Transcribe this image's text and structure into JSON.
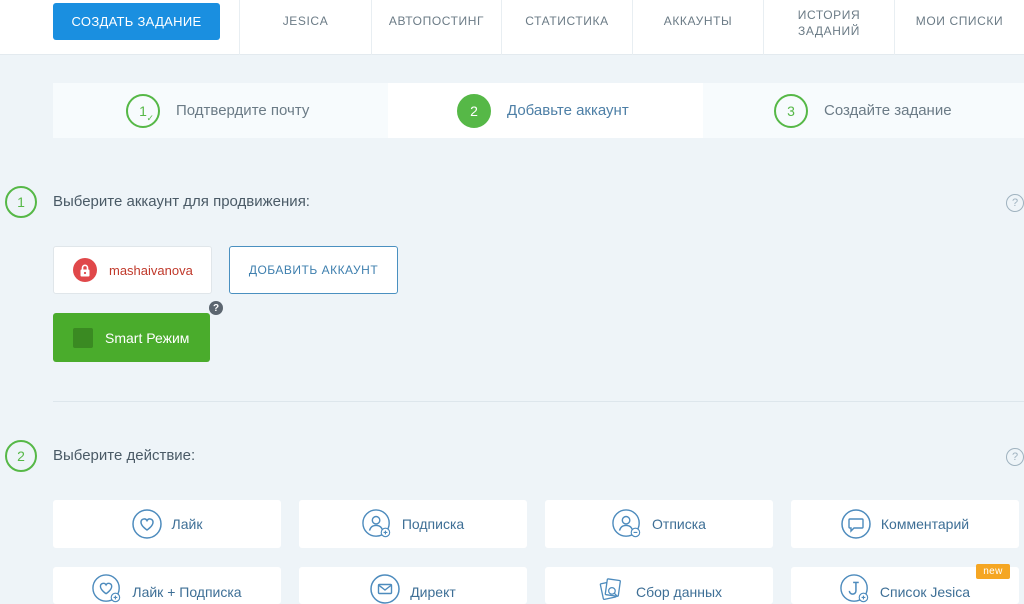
{
  "nav": {
    "create_button": "СОЗДАТЬ ЗАДАНИЕ",
    "tabs": [
      {
        "label": "JESICA"
      },
      {
        "label": "АВТОПОСТИНГ"
      },
      {
        "label": "СТАТИСТИКА"
      },
      {
        "label": "АККАУНТЫ"
      },
      {
        "label": "ИСТОРИЯ\nЗАДАНИЙ"
      },
      {
        "label": "МОИ СПИСКИ"
      }
    ]
  },
  "stepper": {
    "steps": [
      {
        "num": "1",
        "label": "Подтвердите почту",
        "state": "done"
      },
      {
        "num": "2",
        "label": "Добавьте аккаунт",
        "state": "active"
      },
      {
        "num": "3",
        "label": "Создайте задание",
        "state": "pending"
      }
    ]
  },
  "section1": {
    "num": "1",
    "title": "Выберите аккаунт для продвижения:",
    "help": "?",
    "account": {
      "name": "mashaivanova",
      "icon": "lock-icon"
    },
    "add_account": "ДОБАВИТЬ АККАУНТ",
    "smart_mode": "Smart Режим",
    "smart_help": "?"
  },
  "section2": {
    "num": "2",
    "title": "Выберите действие:",
    "help": "?",
    "actions": [
      {
        "label": "Лайк",
        "icon": "heart-icon"
      },
      {
        "label": "Подписка",
        "icon": "user-add-icon"
      },
      {
        "label": "Отписка",
        "icon": "user-remove-icon"
      },
      {
        "label": "Комментарий",
        "icon": "comment-icon"
      },
      {
        "label": "Лайк + Подписка",
        "icon": "heart-add-icon"
      },
      {
        "label": "Директ",
        "icon": "mail-icon"
      },
      {
        "label": "Сбор данных",
        "icon": "data-collect-icon"
      },
      {
        "label": "Список Jesica",
        "icon": "jesica-list-icon"
      }
    ],
    "new_badge": "new"
  },
  "colors": {
    "primary": "#1a8fe0",
    "green": "#56b847",
    "smart_green": "#4aac2c",
    "account_red": "#e0484a",
    "link_blue": "#3e6f96",
    "badge_orange": "#f5a623"
  }
}
